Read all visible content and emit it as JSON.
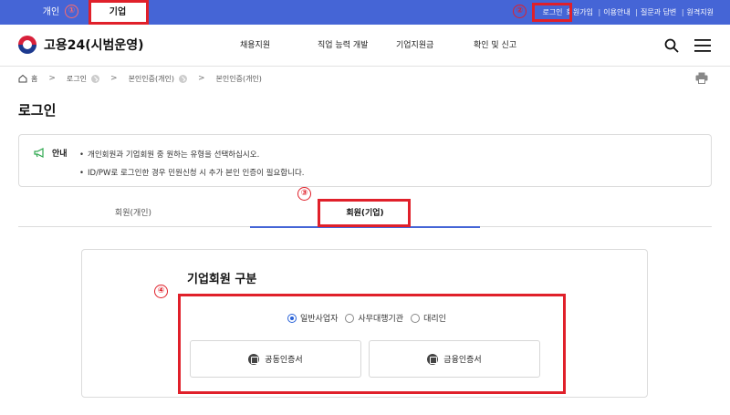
{
  "topbar": {
    "tab_personal": "개인",
    "tab_company": "기업",
    "util": {
      "login": "로그인",
      "signup": "회원가입",
      "guide": "이용안내",
      "qna": "질문과 답변",
      "remote": "원격지원"
    },
    "color": "#4565d6"
  },
  "header": {
    "logo_text": "고용24(시범운영)",
    "nav": [
      "채용지원",
      "직업 능력 개발",
      "기업지원금",
      "확인 및 신고"
    ]
  },
  "breadcrumb": [
    "홈",
    "로그인",
    "본인인증(개인)",
    "본인인증(개인)"
  ],
  "page_title": "로그인",
  "notice": {
    "label": "안내",
    "items": [
      "개인회원과 기업회원 중 원하는 유형을 선택하십시오.",
      "ID/PW로 로그인한 경우 민원신청 시 추가 본인 인증이 필요합니다."
    ]
  },
  "tabs": {
    "personal": "회원(개인)",
    "company": "회원(기업)"
  },
  "login_box": {
    "title": "기업회원 구분",
    "radios": [
      {
        "label": "일반사업자",
        "checked": true
      },
      {
        "label": "사무대행기관",
        "checked": false
      },
      {
        "label": "대리인",
        "checked": false
      }
    ],
    "cert_joint": "공동인증서",
    "cert_financial": "금융인증서"
  },
  "annotations": {
    "n1": "①",
    "n2": "②",
    "n3": "③",
    "n4": "④",
    "color": "#e0202a"
  }
}
